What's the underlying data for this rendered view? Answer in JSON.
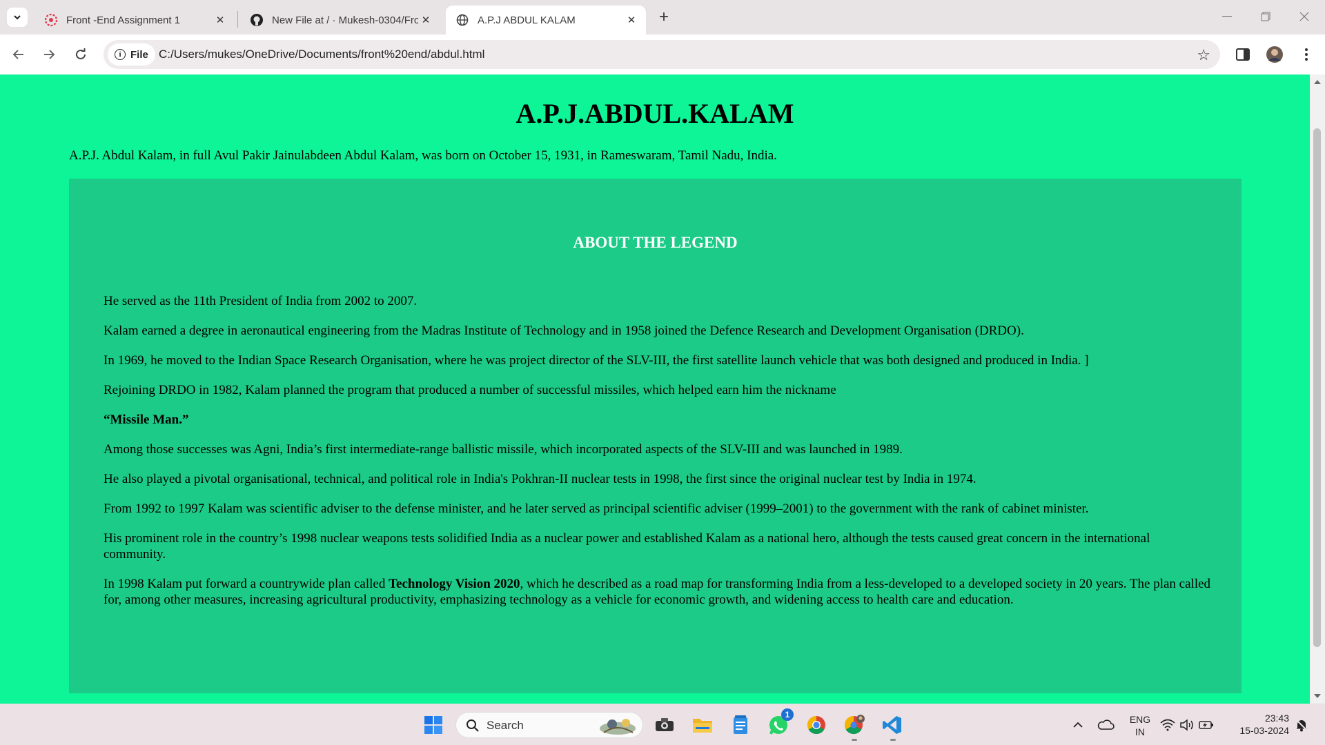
{
  "browser": {
    "tabs": [
      {
        "title": "Front -End Assignment 1",
        "favicon": "red-flower-icon"
      },
      {
        "title": "New File at / · Mukesh-0304/Fro",
        "favicon": "github-icon"
      },
      {
        "title": "A.P.J ABDUL KALAM",
        "favicon": "globe-icon",
        "active": true
      }
    ],
    "site_chip": "File",
    "url": "C:/Users/mukes/OneDrive/Documents/front%20end/abdul.html"
  },
  "page": {
    "title": "A.P.J.ABDUL.KALAM",
    "intro": "A.P.J. Abdul Kalam, in full Avul Pakir Jainulabdeen Abdul Kalam, was born on October 15, 1931, in Rameswaram, Tamil Nadu, India.",
    "legend_heading": "ABOUT THE LEGEND",
    "facts": {
      "p1": "He served as the 11th President of India from 2002 to 2007.",
      "p2": "Kalam earned a degree in aeronautical engineering from the Madras Institute of Technology and in 1958 joined the Defence Research and Development Organisation (DRDO).",
      "p3": "In 1969, he moved to the Indian Space Research Organisation, where he was project director of the SLV-III, the first satellite launch vehicle that was both designed and produced in India. ]",
      "p4": "Rejoining DRDO in 1982, Kalam planned the program that produced a number of successful missiles, which helped earn him the nickname",
      "p5": "“Missile Man.”",
      "p6": "Among those successes was Agni, India’s first intermediate-range ballistic missile, which incorporated aspects of the SLV-III and was launched in 1989.",
      "p7": "He also played a pivotal organisational, technical, and political role in India's Pokhran-II nuclear tests in 1998, the first since the original nuclear test by India in 1974.",
      "p8": "From 1992 to 1997 Kalam was scientific adviser to the defense minister, and he later served as principal scientific adviser (1999–2001) to the government with the rank of cabinet minister.",
      "p9": "His prominent role in the country’s 1998 nuclear weapons tests solidified India as a nuclear power and established Kalam as a national hero, although the tests caused great concern in the international community.",
      "p10_before": "In 1998 Kalam put forward a countrywide plan called ",
      "p10_bold": "Technology Vision 2020",
      "p10_after": ", which he described as a road map for transforming India from a less-developed to a developed society in 20 years. The plan called for, among other measures, increasing agricultural productivity, emphasizing technology as a vehicle for economic growth, and widening access to health care and education."
    }
  },
  "taskbar": {
    "search_label": "Search",
    "whatsapp_badge": "1",
    "lang_top": "ENG",
    "lang_bottom": "IN",
    "time": "23:43",
    "date": "15-03-2024"
  },
  "colors": {
    "page_bg": "#0ef598",
    "legend_box_bg": "#1bcb87",
    "legend_heading": "#ffffff"
  }
}
